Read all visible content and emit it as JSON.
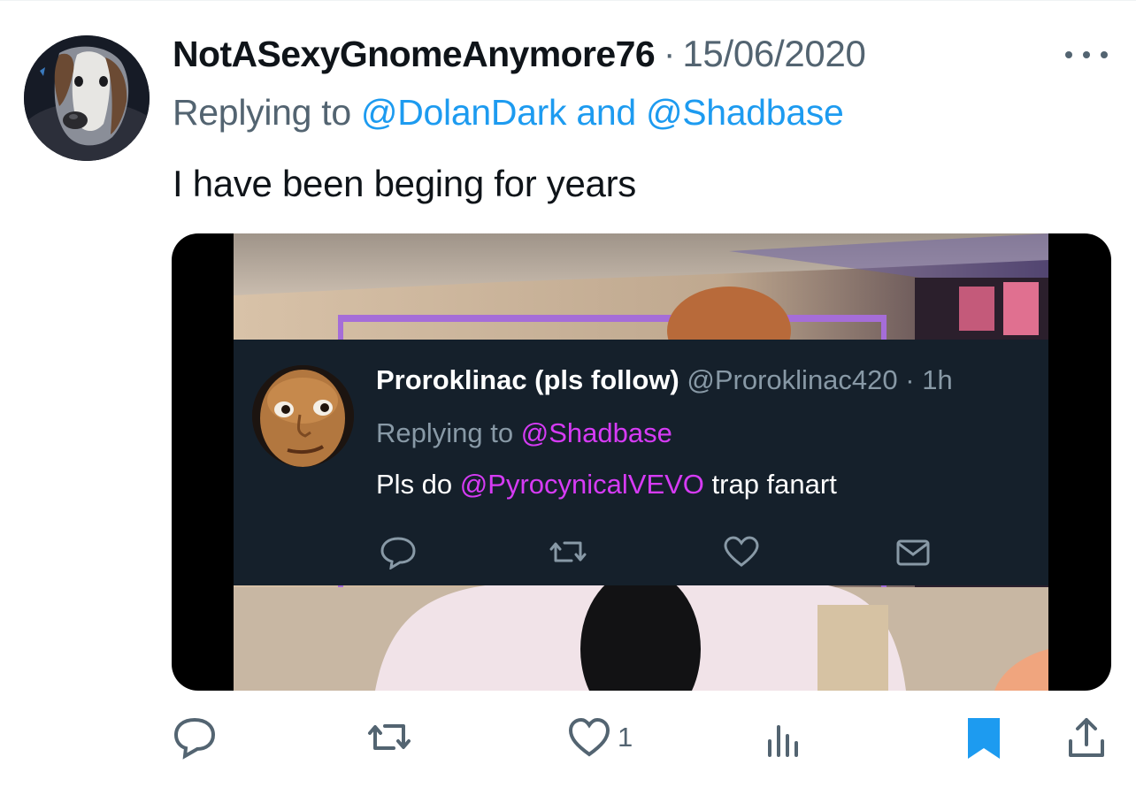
{
  "tweet": {
    "author_name": "NotASexyGnomeAnymore76",
    "separator": "·",
    "date": "15/06/2020",
    "more_icon": "more-horizontal-icon",
    "replying_prefix": "Replying to",
    "reply_mention_1": "@DolanDark",
    "reply_conjunction": "and",
    "reply_mention_2": "@Shadbase",
    "text": "I have been beging for years"
  },
  "embedded_tweet": {
    "author_name": "Proroklinac (pls follow)",
    "handle": "@Proroklinac420",
    "separator": "·",
    "time": "1h",
    "replying_prefix": "Replying to",
    "reply_mention": "@Shadbase",
    "text_before": "Pls do",
    "text_mention": "@PyrocynicalVEVO",
    "text_after": "trap fanart",
    "icons": [
      "reply-icon",
      "retweet-icon",
      "like-icon",
      "message-icon"
    ]
  },
  "actions": {
    "reply_icon": "reply-icon",
    "retweet_icon": "retweet-icon",
    "like_icon": "heart-icon",
    "like_count": "1",
    "views_icon": "analytics-icon",
    "bookmark_icon": "bookmark-icon",
    "share_icon": "share-icon"
  },
  "colors": {
    "link": "#1d9bf0",
    "secondary_text": "#536471",
    "embed_background": "#15202b",
    "embed_mention": "#d63bf5",
    "bookmark_active": "#1d9bf0"
  }
}
